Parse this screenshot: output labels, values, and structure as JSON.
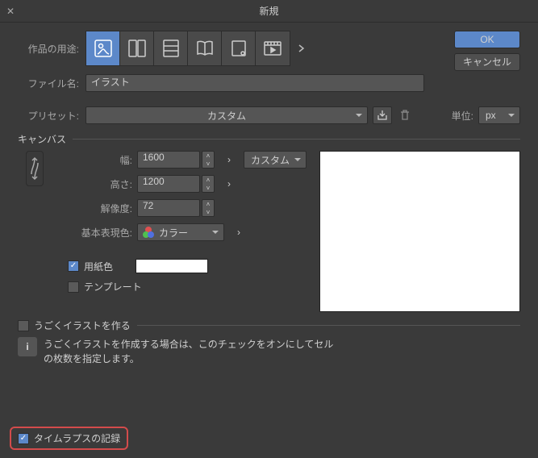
{
  "title": "新規",
  "labels": {
    "use": "作品の用途:",
    "filename": "ファイル名:",
    "preset": "プリセット:",
    "unit": "単位:",
    "canvas": "キャンバス",
    "width": "幅:",
    "height": "高さ:",
    "resolution": "解像度:",
    "colorMode": "基本表現色:",
    "paperColor": "用紙色",
    "template": "テンプレート",
    "animation": "うごくイラストを作る",
    "animationHelp": "うごくイラストを作成する場合は、このチェックをオンにしてセルの枚数を指定します。",
    "timelapse": "タイムラプスの記録"
  },
  "buttons": {
    "ok": "OK",
    "cancel": "キャンセル",
    "custom": "カスタム"
  },
  "values": {
    "filename": "イラスト",
    "preset": "カスタム",
    "unit": "px",
    "width": "1600",
    "height": "1200",
    "resolution": "72",
    "colorMode": "カラー"
  },
  "useIcons": [
    "illustration",
    "comic",
    "webtoon",
    "book",
    "print",
    "animation"
  ],
  "checks": {
    "paperColor": true,
    "template": false,
    "animation": false,
    "timelapse": true
  }
}
